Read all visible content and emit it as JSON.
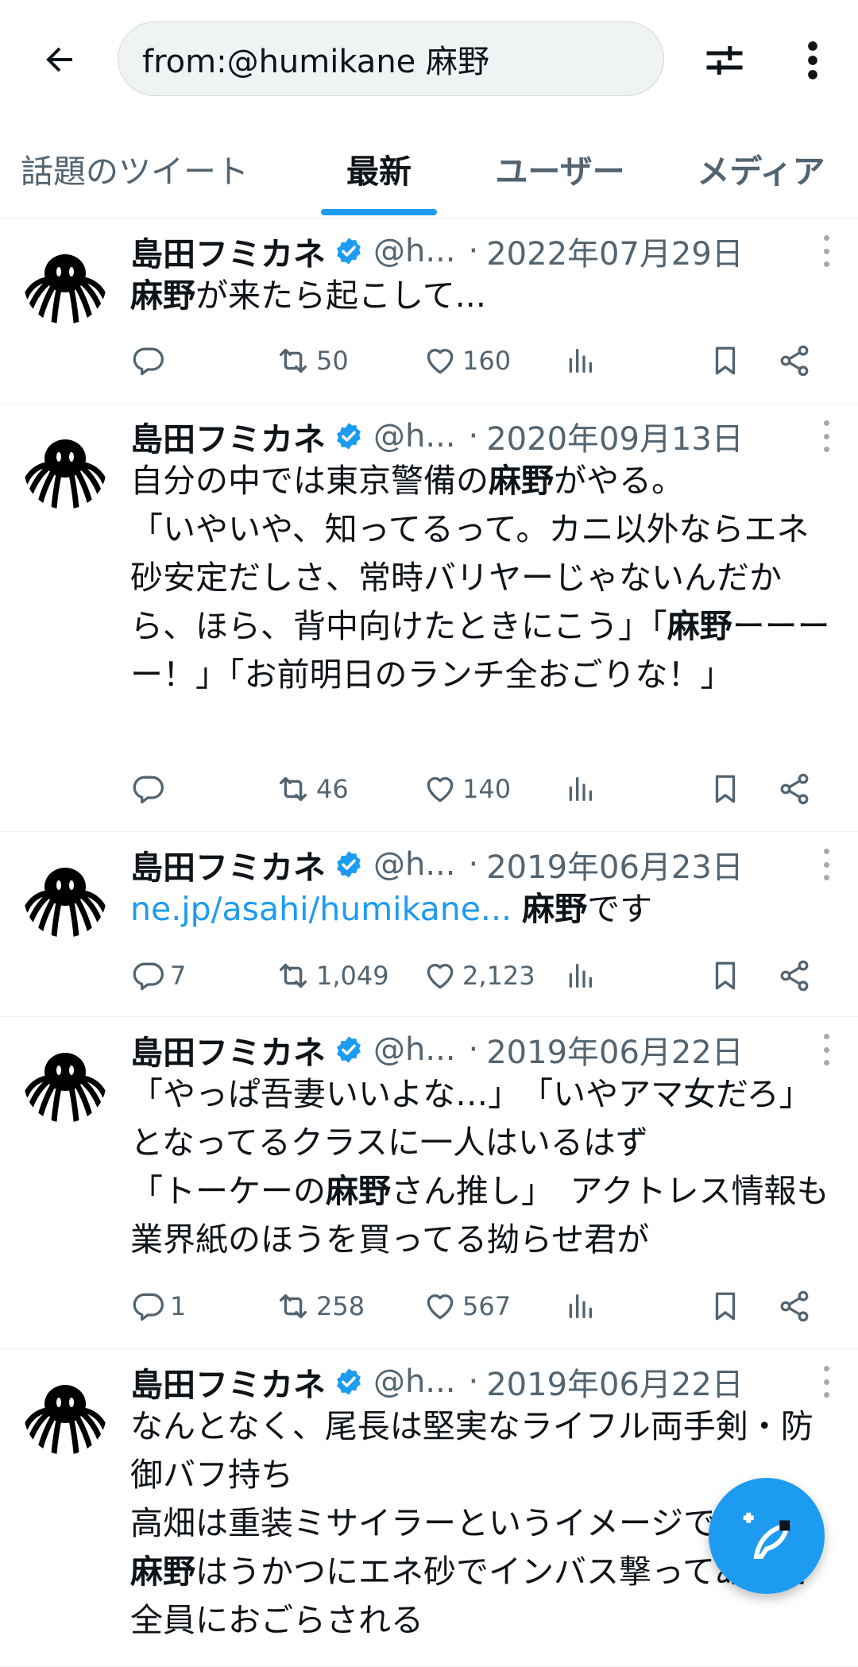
{
  "search": {
    "query": "from:@humikane 麻野"
  },
  "tabs": {
    "top": "話題のツイート",
    "latest": "最新",
    "users": "ユーザー",
    "media": "メディア"
  },
  "tweets": [
    {
      "name": "島田フミカネ",
      "handle": "@h...",
      "sep": "·",
      "date": "2022年07月29日",
      "text": [
        [
          "b",
          "麻野"
        ],
        [
          "t",
          "が来たら起こして..."
        ]
      ],
      "reply": "",
      "retweet": "50",
      "like": "160"
    },
    {
      "name": "島田フミカネ",
      "handle": "@h...",
      "sep": "·",
      "date": "2020年09月13日",
      "text": [
        [
          "t",
          "自分の中では東京警備の"
        ],
        [
          "b",
          "麻野"
        ],
        [
          "t",
          "がやる。"
        ],
        [
          "br",
          ""
        ],
        [
          "t",
          "「いやいや、知ってるって。カニ以外ならエネ砂安定だしさ、常時バリヤーじゃないんだから、ほら、背中向けたときにこう」「"
        ],
        [
          "b",
          "麻野"
        ],
        [
          "t",
          "ーーーー！」「お前明日のランチ全おごりな！」"
        ]
      ],
      "reply": "",
      "retweet": "46",
      "like": "140"
    },
    {
      "name": "島田フミカネ",
      "handle": "@h...",
      "sep": "·",
      "date": "2019年06月23日",
      "text": [
        [
          "l",
          "ne.jp/asahi/humikane..."
        ],
        [
          "t",
          " "
        ],
        [
          "b",
          "麻野"
        ],
        [
          "t",
          "です"
        ]
      ],
      "reply": "7",
      "retweet": "1,049",
      "like": "2,123"
    },
    {
      "name": "島田フミカネ",
      "handle": "@h...",
      "sep": "·",
      "date": "2019年06月22日",
      "text": [
        [
          "t",
          "「やっぱ吾妻いいよな…」　「いやアマ女だろ」となってるクラスに一人はいるはず"
        ],
        [
          "br",
          ""
        ],
        [
          "t",
          "「トーケーの"
        ],
        [
          "b",
          "麻野"
        ],
        [
          "t",
          "さん推し」　アクトレス情報も業界紙のほうを買ってる拗らせ君が"
        ]
      ],
      "reply": "1",
      "retweet": "258",
      "like": "567"
    },
    {
      "name": "島田フミカネ",
      "handle": "@h...",
      "sep": "·",
      "date": "2019年06月22日",
      "text": [
        [
          "t",
          "なんとなく、尾長は堅実なライフル両手剣・防御バフ持ち"
        ],
        [
          "br",
          ""
        ],
        [
          "t",
          "高畑は重装ミサイラーというイメージで、"
        ],
        [
          "br",
          ""
        ],
        [
          "b",
          "麻野"
        ],
        [
          "t",
          "はうかつにエネ砂でインバス撃ってあとで全員におごらされる"
        ]
      ],
      "reply": "",
      "retweet": "",
      "like": ""
    }
  ],
  "icons": {
    "back": "arrow-left-icon",
    "filter": "sliders-icon",
    "more": "more-vertical-icon",
    "reply": "reply-icon",
    "retweet": "retweet-icon",
    "like": "heart-icon",
    "views": "analytics-icon",
    "bookmark": "bookmark-icon",
    "share": "share-icon",
    "compose": "compose-icon",
    "verified": "verified-badge-icon"
  },
  "colors": {
    "accent": "#1d9bf0",
    "muted": "#536471",
    "text": "#0f1419"
  }
}
